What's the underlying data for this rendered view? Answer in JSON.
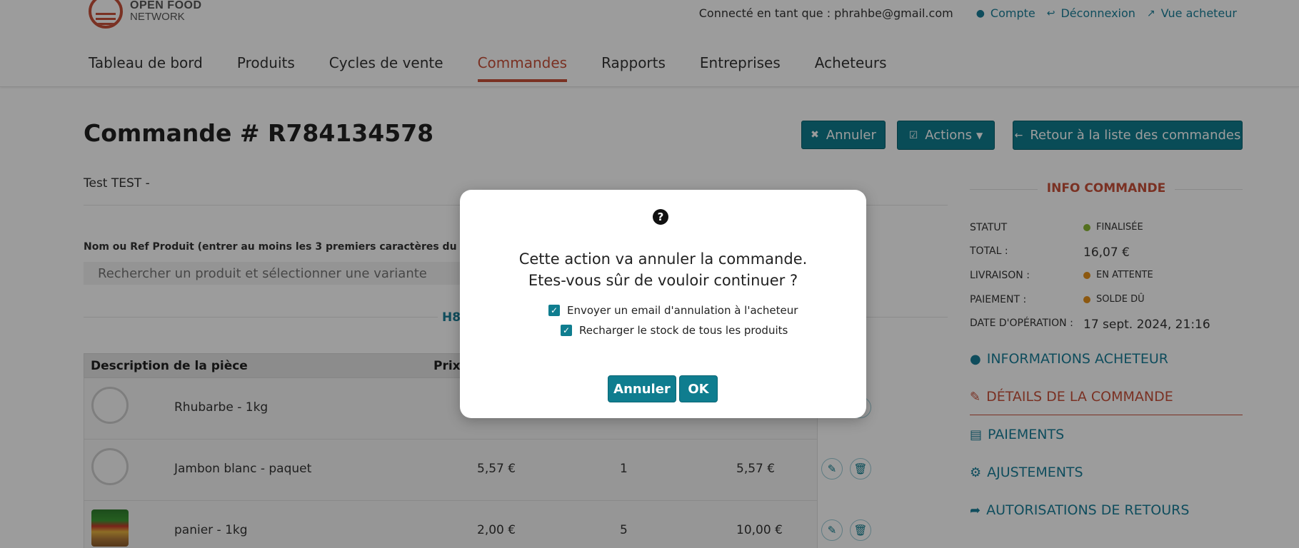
{
  "header": {
    "logo": {
      "line1": "OPEN FOOD",
      "line2": "NETWORK"
    },
    "user_text": "Connecté en tant que : phrahbe@gmail.com",
    "links": {
      "account": "Compte",
      "logout": "Déconnexion",
      "shopfront": "Vue acheteur"
    },
    "nav": [
      "Tableau de bord",
      "Produits",
      "Cycles de vente",
      "Commandes",
      "Rapports",
      "Entreprises",
      "Acheteurs"
    ],
    "active_nav": "Commandes"
  },
  "page": {
    "title": "Commande # R784134578",
    "buttons": {
      "cancel": "Annuler",
      "actions": "Actions",
      "back": "Retour à la liste des commandes"
    },
    "customer": "Test TEST -",
    "search_label": "Nom ou Ref Produit (entrer au moins les 3 premiers caractères du nom du produit)",
    "search_placeholder": "Rechercher un produit et sélectionner une variante",
    "shipment_code": "H80"
  },
  "table": {
    "headers": {
      "description": "Description de la pièce",
      "price": "Prix"
    },
    "rows": [
      {
        "name": "Rhubarbe - 1kg",
        "price": "",
        "qty": "",
        "total": ""
      },
      {
        "name": "Jambon blanc - paquet",
        "price": "5,57 €",
        "qty": "1",
        "total": "5,57 €"
      },
      {
        "name": "panier - 1kg",
        "price": "2,00 €",
        "qty": "5",
        "total": "10,00 €"
      }
    ]
  },
  "info": {
    "heading": "INFO COMMANDE",
    "status_label": "STATUT",
    "status_value": "FINALISÉE",
    "total_label": "TOTAL :",
    "total_value": "16,07 €",
    "delivery_label": "LIVRAISON :",
    "delivery_value": "EN ATTENTE",
    "payment_label": "PAIEMENT :",
    "payment_value": "SOLDE DÛ",
    "date_label": "DATE D'OPÉRATION :",
    "date_value": "17 sept. 2024, 21:16",
    "status_colors": {
      "done": "#8ab833",
      "pending": "#e5911b"
    }
  },
  "sidebar": {
    "links": [
      "INFORMATIONS ACHETEUR",
      "DÉTAILS DE LA COMMANDE",
      "PAIEMENTS",
      "AJUSTEMENTS",
      "AUTORISATIONS DE RETOURS"
    ],
    "active": "DÉTAILS DE LA COMMANDE"
  },
  "modal": {
    "icon": "question-circle-icon",
    "message_line1": "Cette action va annuler la commande.",
    "message_line2": "Etes-vous sûr de vouloir continuer ?",
    "checkbox_email": {
      "label": "Envoyer un email d'annulation à l'acheteur",
      "checked": true
    },
    "checkbox_restock": {
      "label": "Recharger le stock de tous les produits",
      "checked": true
    },
    "cancel_label": "Annuler",
    "ok_label": "OK"
  },
  "colors": {
    "accent": "#0f7d8f",
    "brand": "#c8513a",
    "link": "#1a7e98"
  }
}
